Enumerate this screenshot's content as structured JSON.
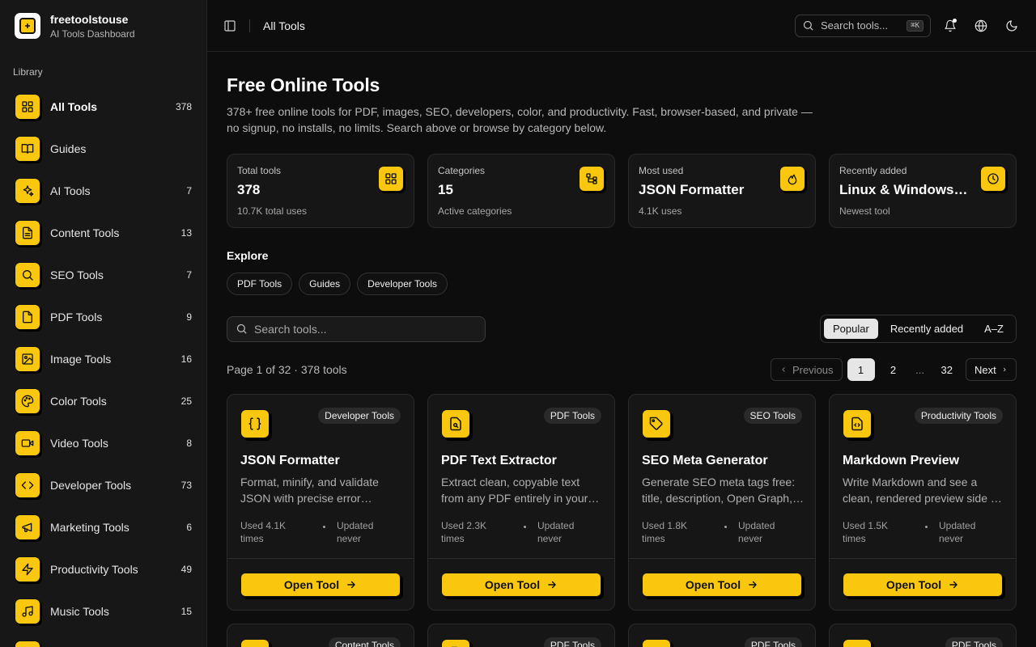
{
  "brand": {
    "name": "freetoolstouse",
    "subtitle": "AI Tools Dashboard"
  },
  "sidebar": {
    "section_label": "Library",
    "items": [
      {
        "label": "All Tools",
        "count": "378",
        "icon": "grid-icon",
        "active": true
      },
      {
        "label": "Guides",
        "count": "",
        "icon": "book-icon"
      },
      {
        "label": "AI Tools",
        "count": "7",
        "icon": "sparkles-icon"
      },
      {
        "label": "Content Tools",
        "count": "13",
        "icon": "file-text-icon"
      },
      {
        "label": "SEO Tools",
        "count": "7",
        "icon": "search-icon"
      },
      {
        "label": "PDF Tools",
        "count": "9",
        "icon": "file-icon"
      },
      {
        "label": "Image Tools",
        "count": "16",
        "icon": "image-icon"
      },
      {
        "label": "Color Tools",
        "count": "25",
        "icon": "palette-icon"
      },
      {
        "label": "Video Tools",
        "count": "8",
        "icon": "video-icon"
      },
      {
        "label": "Developer Tools",
        "count": "73",
        "icon": "code-icon"
      },
      {
        "label": "Marketing Tools",
        "count": "6",
        "icon": "megaphone-icon"
      },
      {
        "label": "Productivity Tools",
        "count": "49",
        "icon": "zap-icon"
      },
      {
        "label": "Music Tools",
        "count": "15",
        "icon": "music-icon"
      }
    ]
  },
  "topbar": {
    "title": "All Tools",
    "search_placeholder": "Search tools...",
    "shortcut": "⌘K"
  },
  "page": {
    "title": "Free Online Tools",
    "description": "378+ free online tools for PDF, images, SEO, developers, color, and productivity. Fast, browser-based, and private — no signup, no installs, no limits. Search above or browse by category below."
  },
  "stats": [
    {
      "label": "Total tools",
      "value": "378",
      "sub": "10.7K total uses",
      "icon": "grid-icon"
    },
    {
      "label": "Categories",
      "value": "15",
      "sub": "Active categories",
      "icon": "tree-icon"
    },
    {
      "label": "Most used",
      "value": "JSON Formatter",
      "sub": "4.1K uses",
      "icon": "flame-icon"
    },
    {
      "label": "Recently added",
      "value": "Linux & Windows Command Cheatsheet",
      "sub": "Newest tool",
      "icon": "clock-icon"
    }
  ],
  "explore": {
    "label": "Explore",
    "chips": [
      "PDF Tools",
      "Guides",
      "Developer Tools"
    ]
  },
  "filter": {
    "search_placeholder": "Search tools...",
    "sort_options": [
      "Popular",
      "Recently added",
      "A–Z"
    ],
    "active_sort": "Popular"
  },
  "pagination": {
    "info": "Page 1 of 32 · 378 tools",
    "previous": "Previous",
    "pages": [
      "1",
      "2",
      "...",
      "32"
    ],
    "current": "1",
    "next": "Next"
  },
  "cards": [
    {
      "title": "JSON Formatter",
      "badge": "Developer Tools",
      "description": "Format, minify, and validate JSON with precise error reporting.",
      "used": "Used 4.1K times",
      "updated": "Updated never",
      "button": "Open Tool",
      "icon": "braces-icon"
    },
    {
      "title": "PDF Text Extractor",
      "badge": "PDF Tools",
      "description": "Extract clean, copyable text from any PDF entirely in your browser.",
      "used": "Used 2.3K times",
      "updated": "Updated never",
      "button": "Open Tool",
      "icon": "file-search-icon"
    },
    {
      "title": "SEO Meta Generator",
      "badge": "SEO Tools",
      "description": "Generate SEO meta tags free: title, description, Open Graph, Twitter.",
      "used": "Used 1.8K times",
      "updated": "Updated never",
      "button": "Open Tool",
      "icon": "tag-icon"
    },
    {
      "title": "Markdown Preview",
      "badge": "Productivity Tools",
      "description": "Write Markdown and see a clean, rendered preview side by side.",
      "used": "Used 1.5K times",
      "updated": "Updated never",
      "button": "Open Tool",
      "icon": "file-code-icon"
    }
  ],
  "cards_row2": [
    {
      "badge": "Content Tools",
      "icon": "type-icon"
    },
    {
      "badge": "PDF Tools",
      "icon": "file-edit-icon"
    },
    {
      "badge": "PDF Tools",
      "icon": "scan-icon"
    },
    {
      "badge": "PDF Tools",
      "icon": "scissors-icon"
    }
  ],
  "colors": {
    "accent": "#f9c80e",
    "background": "#0d0d0d",
    "sidebar": "#171717",
    "card": "#161616"
  }
}
